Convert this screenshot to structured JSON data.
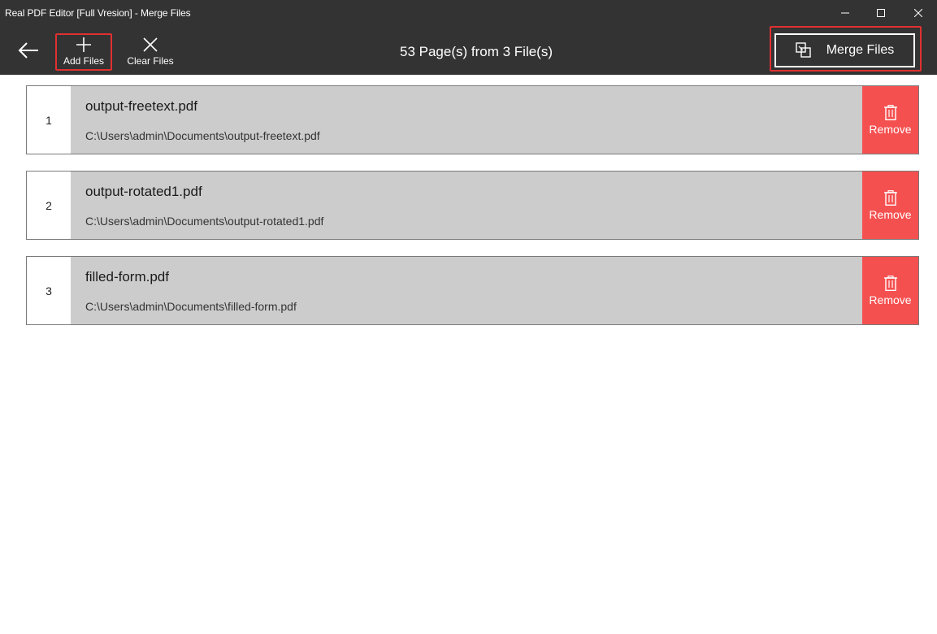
{
  "window": {
    "title": "Real PDF Editor [Full Vresion] - Merge Files"
  },
  "toolbar": {
    "back_icon": "arrow-left-icon",
    "add_files_label": "Add Files",
    "clear_files_label": "Clear Files",
    "summary": "53 Page(s) from 3 File(s)",
    "merge_files_label": "Merge Files"
  },
  "files": [
    {
      "index": "1",
      "name": "output-freetext.pdf",
      "path": "C:\\Users\\admin\\Documents\\output-freetext.pdf",
      "remove_label": "Remove"
    },
    {
      "index": "2",
      "name": "output-rotated1.pdf",
      "path": "C:\\Users\\admin\\Documents\\output-rotated1.pdf",
      "remove_label": "Remove"
    },
    {
      "index": "3",
      "name": "filled-form.pdf",
      "path": "C:\\Users\\admin\\Documents\\filled-form.pdf",
      "remove_label": "Remove"
    }
  ],
  "colors": {
    "titlebar_bg": "#333333",
    "row_bg": "#cccccc",
    "remove_bg": "#f55050",
    "highlight": "#e03030"
  }
}
